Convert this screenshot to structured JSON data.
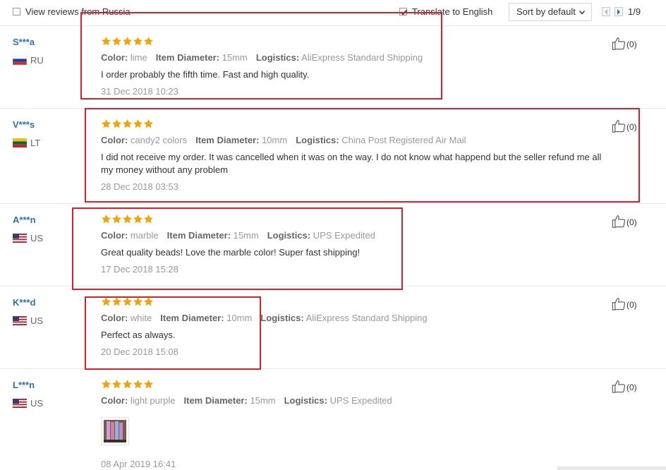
{
  "topbar": {
    "view_reviews_label": "View reviews from Russia",
    "translate_label": "Translate to English",
    "sort_label": "Sort by default",
    "page_indicator": "1/9"
  },
  "colors": {
    "accent_red": "#d8212a",
    "username_blue": "#2f6fb7",
    "star_orange": "#f0a30a"
  },
  "reviews": [
    {
      "user": "S***a",
      "country": "RU",
      "rating": 5,
      "attr1_label": "Color:",
      "attr1_value": "lime",
      "attr2_label": "Item Diameter:",
      "attr2_value": "15mm",
      "attr3_label": "Logistics:",
      "attr3_value": "AliExpress Standard Shipping",
      "text_line1": "I order probably the fifth time. Fast and high quality.",
      "text_line2": "",
      "date": "31 Dec 2018 10:23",
      "helpful": "(0)"
    },
    {
      "user": "V***s",
      "country": "LT",
      "rating": 5,
      "attr1_label": "Color:",
      "attr1_value": "candy2 colors",
      "attr2_label": "Item Diameter:",
      "attr2_value": "10mm",
      "attr3_label": "Logistics:",
      "attr3_value": "China Post Registered Air Mail",
      "text_line1": "I did not receive my order. It was cancelled when it was on the way. I do not know what happend but the seller refund me all",
      "text_line2": "my money without any problem",
      "date": "28 Dec 2018 03:53",
      "helpful": "(0)"
    },
    {
      "user": "A***n",
      "country": "US",
      "rating": 5,
      "attr1_label": "Color:",
      "attr1_value": "marble",
      "attr2_label": "Item Diameter:",
      "attr2_value": "15mm",
      "attr3_label": "Logistics:",
      "attr3_value": "UPS Expedited",
      "text_line1": "Great quality beads! Love the marble color! Super fast shipping!",
      "text_line2": "",
      "date": "17 Dec 2018 15:28",
      "helpful": "(0)"
    },
    {
      "user": "K***d",
      "country": "US",
      "rating": 5,
      "attr1_label": "Color:",
      "attr1_value": "white",
      "attr2_label": "Item Diameter:",
      "attr2_value": "10mm",
      "attr3_label": "Logistics:",
      "attr3_value": "AliExpress Standard Shipping",
      "text_line1": "Perfect as always.",
      "text_line2": "",
      "date": "20 Dec 2018 15:08",
      "helpful": "(0)"
    },
    {
      "user": "L***n",
      "country": "US",
      "rating": 5,
      "attr1_label": "Color:",
      "attr1_value": "light purple",
      "attr2_label": "Item Diameter:",
      "attr2_value": "15mm",
      "attr3_label": "Logistics:",
      "attr3_value": "UPS Expedited",
      "text_line1": "",
      "text_line2": "",
      "date": "08 Apr 2019 16:41",
      "helpful": "(0)"
    }
  ]
}
